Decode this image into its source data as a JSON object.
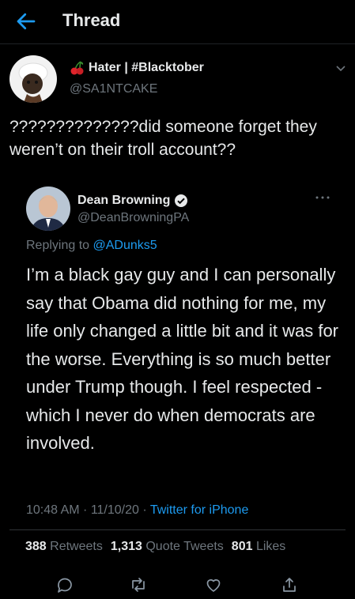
{
  "header": {
    "title": "Thread"
  },
  "tweet": {
    "display_name": "Hater | #Blacktober",
    "handle": "@SA1NTCAKE",
    "text": "??????????????did someone forget they weren’t on their troll account??"
  },
  "quote": {
    "display_name": "Dean Browning",
    "handle": "@DeanBrowningPA",
    "replying_prefix": "Replying to",
    "replying_to": "@ADunks5",
    "text": "I’m a black gay guy and I can personally say that Obama did nothing for me, my life only changed a little bit and it was for the worse. Everything is so much better under Trump though. I feel respected - which I never do when democrats are involved.",
    "time": "10:48 AM · 11/10/20 ·",
    "source": "Twitter for iPhone"
  },
  "stats": {
    "retweets_count": "388",
    "retweets_label": "Retweets",
    "quote_count": "1,313",
    "quote_label": "Quote Tweets",
    "likes_count": "801",
    "likes_label": "Likes"
  },
  "colors": {
    "accent": "#1d9bf0",
    "muted": "#6e767d",
    "background": "#000000",
    "text": "#e7e9ea"
  },
  "icons": [
    "back-arrow-icon",
    "cherry-icon",
    "chevron-down-icon",
    "verified-badge-icon",
    "more-icon",
    "reply-icon",
    "retweet-icon",
    "like-icon",
    "share-icon"
  ]
}
